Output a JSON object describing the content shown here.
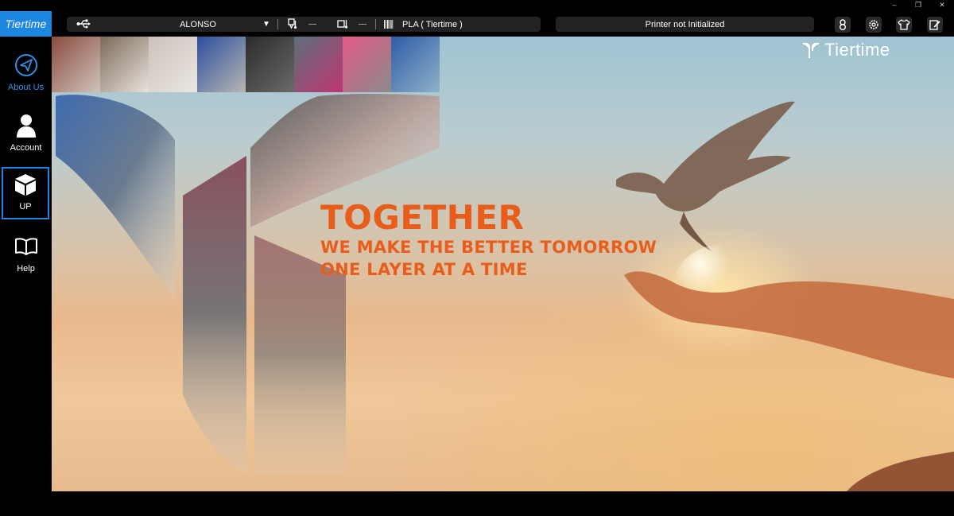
{
  "window": {
    "controls": [
      "–",
      "❐",
      "✕"
    ]
  },
  "logo": {
    "text": "Tiertime"
  },
  "sidebar": {
    "items": [
      {
        "label": "About Us",
        "icon": "paper-plane-icon",
        "active_color": "#2e8fe6"
      },
      {
        "label": "Account",
        "icon": "user-icon"
      },
      {
        "label": "UP",
        "icon": "cube-icon",
        "selected": true
      },
      {
        "label": "Help",
        "icon": "book-icon"
      }
    ]
  },
  "toolbar": {
    "usb_icon": "usb-icon",
    "printer_name": "ALONSO",
    "dropdown_glyph": "▼",
    "nozzle_temp": "—",
    "bed_temp": "—",
    "material": "PLA ( Tiertime )"
  },
  "status": {
    "text": "Printer not Initialized"
  },
  "top_icons": [
    "user-settings-icon",
    "gear-icon",
    "shirt-icon",
    "edit-icon"
  ],
  "banner": {
    "brand": "Tiertime",
    "headline": "TOGETHER",
    "line1": "WE MAKE THE BETTER TOMORROW",
    "line2": "ONE LAYER AT A TIME",
    "accent_color": "#e85d1a"
  },
  "colors": {
    "brand_blue": "#1d86e0",
    "toolbar_bg": "#222222",
    "sidebar_bg": "#000000"
  }
}
